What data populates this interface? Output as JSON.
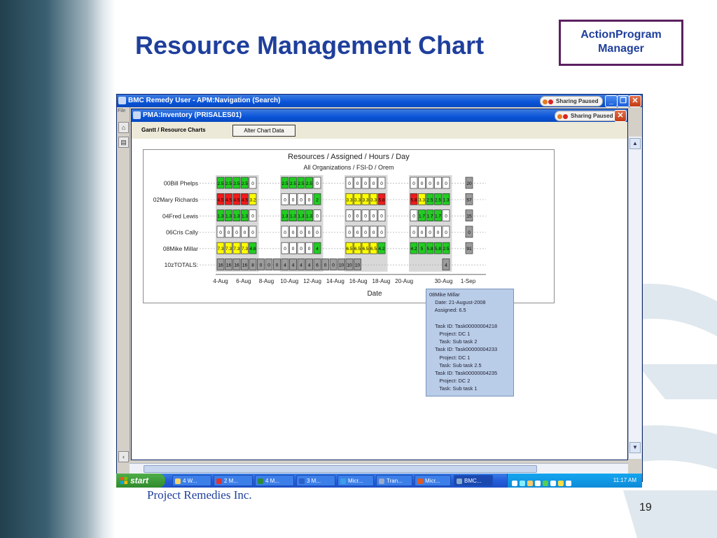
{
  "slide": {
    "title": "Resource Management Chart",
    "badge_line1": "ActionProgram",
    "badge_line2": "Manager",
    "company": "Project Remedies Inc.",
    "page_number": "19"
  },
  "outer_window": {
    "title": "BMC Remedy User - APM:Navigation (Search)",
    "sharing": "Sharing Paused",
    "menu_stub": "File"
  },
  "inner_window": {
    "title": "PMA:Inventory (PRISALES01)",
    "sharing": "Sharing Paused",
    "tab_label": "Gantt / Resource Charts",
    "alter_button": "Alter Chart Data"
  },
  "chart_data": {
    "type": "heatmap",
    "title": "Resources / Assigned / Hours / Day",
    "subtitle": "All Organizations / FSI-D / Orem",
    "xlabel": "Date",
    "x_ticks": [
      "4-Aug",
      "6-Aug",
      "8-Aug",
      "10-Aug",
      "12-Aug",
      "14-Aug",
      "16-Aug",
      "18-Aug",
      "20-Aug",
      "30-Aug",
      "1-Sep"
    ],
    "rows": [
      {
        "name": "00Bill Phelps",
        "cells": [
          "2.5",
          "2.5",
          "2.5",
          "2.5",
          "0",
          "",
          "",
          "",
          "2.5",
          "2.5",
          "2.5",
          "2.5",
          "0",
          "",
          "",
          "",
          "0",
          "0",
          "0",
          "0",
          "0",
          "",
          "",
          "",
          "0",
          "0",
          "0",
          "0",
          "0",
          "",
          "",
          "20"
        ],
        "colors": [
          "g",
          "g",
          "g",
          "g",
          "w",
          "",
          "",
          "",
          "g",
          "g",
          "g",
          "g",
          "w",
          "",
          "",
          "",
          "w",
          "w",
          "w",
          "w",
          "w",
          "",
          "",
          "",
          "w",
          "w",
          "w",
          "w",
          "w",
          "",
          "",
          "t"
        ]
      },
      {
        "name": "02Mary Richards",
        "cells": [
          "4.5",
          "4.5",
          "4.5",
          "4.5",
          "3.2",
          "",
          "",
          "",
          "0",
          "0",
          "0",
          "0",
          "2",
          "",
          "",
          "",
          "3.3",
          "3.3",
          "3.3",
          "3.3",
          "5.8",
          "",
          "",
          "",
          "5.8",
          "3.3",
          "2.5",
          "2.5",
          "1.3",
          "",
          "",
          "57"
        ],
        "colors": [
          "r",
          "r",
          "r",
          "r",
          "y",
          "",
          "",
          "",
          "w",
          "w",
          "w",
          "w",
          "g",
          "",
          "",
          "",
          "y",
          "y",
          "y",
          "y",
          "r",
          "",
          "",
          "",
          "r",
          "y",
          "g",
          "g",
          "g",
          "",
          "",
          "t"
        ]
      },
      {
        "name": "04Fred Lewis",
        "cells": [
          "1.3",
          "1.3",
          "1.3",
          "1.3",
          "0",
          "",
          "",
          "",
          "1.3",
          "1.3",
          "1.3",
          "1.3",
          "0",
          "",
          "",
          "",
          "0",
          "0",
          "0",
          "0",
          "0",
          "",
          "",
          "",
          "0",
          "1.7",
          "1.7",
          "1.7",
          "0",
          "",
          "",
          "15"
        ],
        "colors": [
          "g",
          "g",
          "g",
          "g",
          "w",
          "",
          "",
          "",
          "g",
          "g",
          "g",
          "g",
          "w",
          "",
          "",
          "",
          "w",
          "w",
          "w",
          "w",
          "w",
          "",
          "",
          "",
          "w",
          "g",
          "g",
          "g",
          "w",
          "",
          "",
          "t"
        ]
      },
      {
        "name": "06Cris Cally",
        "cells": [
          "0",
          "0",
          "0",
          "0",
          "0",
          "",
          "",
          "",
          "0",
          "0",
          "0",
          "0",
          "0",
          "",
          "",
          "",
          "0",
          "0",
          "0",
          "0",
          "0",
          "",
          "",
          "",
          "0",
          "0",
          "0",
          "0",
          "0",
          "",
          "",
          "0"
        ],
        "colors": [
          "w",
          "w",
          "w",
          "w",
          "w",
          "",
          "",
          "",
          "w",
          "w",
          "w",
          "w",
          "w",
          "",
          "",
          "",
          "w",
          "w",
          "w",
          "w",
          "w",
          "",
          "",
          "",
          "w",
          "w",
          "w",
          "w",
          "w",
          "",
          "",
          "t"
        ]
      },
      {
        "name": "08Mike Millar",
        "cells": [
          "7.3",
          "7.3",
          "7.3",
          "7.3",
          "4.8",
          "",
          "",
          "",
          "0",
          "0",
          "0",
          "0",
          "4",
          "",
          "",
          "",
          "6.5",
          "6.5",
          "6.5",
          "6.5",
          "4.2",
          "",
          "",
          "",
          "4.2",
          "5",
          "5.8",
          "5.8",
          "2.5",
          "",
          "",
          "91"
        ],
        "colors": [
          "y",
          "y",
          "y",
          "y",
          "g",
          "",
          "",
          "",
          "w",
          "w",
          "w",
          "w",
          "g",
          "",
          "",
          "",
          "y",
          "y",
          "y",
          "y",
          "g",
          "",
          "",
          "",
          "g",
          "g",
          "g",
          "g",
          "g",
          "",
          "",
          "t"
        ]
      },
      {
        "name": "10zTOTALS:",
        "cells": [
          "16",
          "16",
          "16",
          "16",
          "8",
          "0",
          "0",
          "0",
          "4",
          "4",
          "4",
          "4",
          "6",
          "0",
          "0",
          "10",
          "10",
          "10",
          "",
          "",
          "",
          "",
          "",
          "",
          "",
          "",
          "",
          "",
          "4",
          "",
          "",
          ""
        ],
        "colors": [
          "t",
          "t",
          "t",
          "t",
          "t",
          "t",
          "t",
          "t",
          "t",
          "t",
          "t",
          "t",
          "t",
          "t",
          "t",
          "t",
          "t",
          "t",
          "",
          "",
          "",
          "",
          "",
          "",
          "",
          "",
          "",
          "",
          "t",
          "",
          "",
          ""
        ]
      }
    ],
    "legend_colors": {
      "g": "#22cc22",
      "y": "#ffff00",
      "r": "#ee1c1c",
      "w": "#ffffff",
      "t": "#9c9c9c"
    }
  },
  "tooltip": {
    "text": "08Mike Millar\n    Date: 21-August-2008\n    Assigned: 6.5\n\n    Task ID: Task00000004218\n       Project: DC 1\n       Task: Sub task 2\n    Task ID: Task00000004233\n       Project: DC 1\n       Task: Sub task 2.5\n    Task ID: Task00000004235\n       Project: DC 2\n       Task: Sub task 1"
  },
  "taskbar": {
    "start": "start",
    "items": [
      "4 W...",
      "2 M...",
      "4 M...",
      "3 M...",
      "Micr...",
      "Tran...",
      "Micr...",
      "BMC..."
    ],
    "clock": "11:17 AM"
  }
}
